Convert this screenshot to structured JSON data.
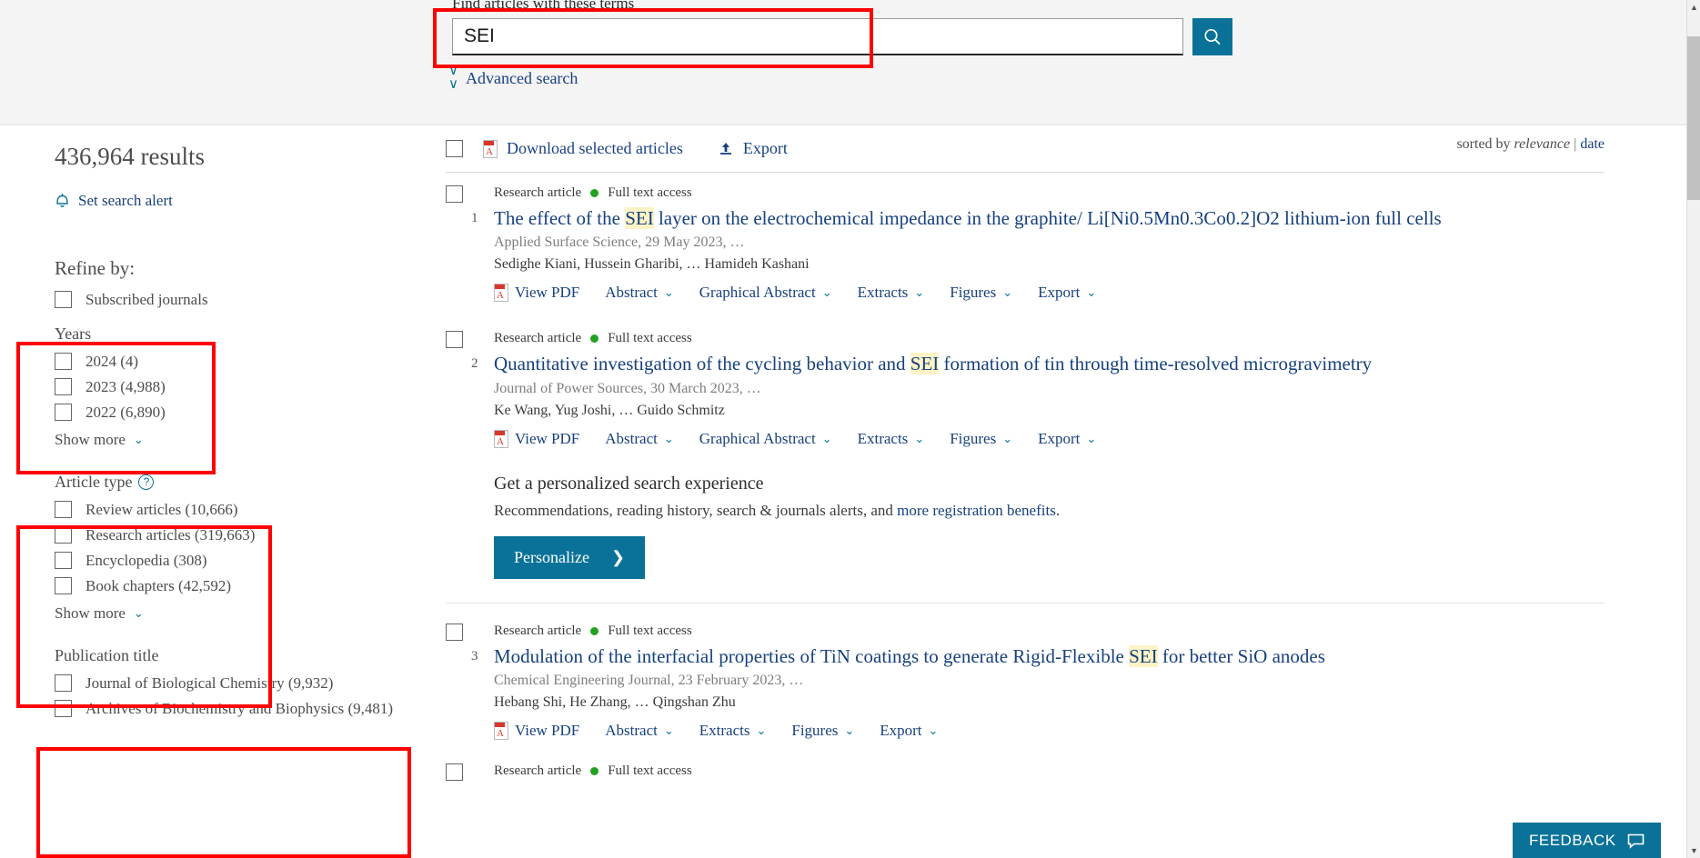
{
  "search": {
    "label": "Find articles with these terms",
    "value": "SEI",
    "placeholder": "",
    "button_icon": "search-icon",
    "advanced_search": "Advanced search"
  },
  "sidebar": {
    "results_count": "436,964 results",
    "set_alert": "Set search alert",
    "refine_title": "Refine by:",
    "subscribed": {
      "label": "Subscribed journals"
    },
    "facets": [
      {
        "title": "Years",
        "help": false,
        "options": [
          {
            "label": "2024 (4)"
          },
          {
            "label": "2023 (4,988)"
          },
          {
            "label": "2022 (6,890)"
          }
        ],
        "show_more": "Show more"
      },
      {
        "title": "Article type",
        "help": true,
        "help_glyph": "?",
        "options": [
          {
            "label": "Review articles (10,666)"
          },
          {
            "label": "Research articles (319,663)"
          },
          {
            "label": "Encyclopedia (308)"
          },
          {
            "label": "Book chapters (42,592)"
          }
        ],
        "show_more": "Show more"
      },
      {
        "title": "Publication title",
        "help": false,
        "options": [
          {
            "label": "Journal of Biological Chemistry (9,932)"
          },
          {
            "label": "Archives of Biochemistry and Biophysics (9,481)"
          }
        ],
        "show_more": ""
      }
    ]
  },
  "toolbar": {
    "download_label": "Download selected articles",
    "export_label": "Export",
    "sorted_by_prefix": "sorted by ",
    "sort_relevance": "relevance",
    "sort_separator": "|",
    "sort_date": "date"
  },
  "results": [
    {
      "number": "1",
      "type": "Research article",
      "access": "Full text access",
      "title_pre": "The effect of the ",
      "title_hl": "SEI",
      "title_post": " layer on the electrochemical impedance in the graphite/ Li[Ni0.5Mn0.3Co0.2]O2 lithium-ion full cells",
      "meta": "Applied Surface Science, 29 May 2023, …",
      "authors": "Sedighe Kiani, Hussein Gharibi, … Hamideh Kashani",
      "actions": [
        "View PDF",
        "Abstract",
        "Graphical Abstract",
        "Extracts",
        "Figures",
        "Export"
      ]
    },
    {
      "number": "2",
      "type": "Research article",
      "access": "Full text access",
      "title_pre": "Quantitative investigation of the cycling behavior and ",
      "title_hl": "SEI",
      "title_post": " formation of tin through time-resolved microgravimetry",
      "meta": "Journal of Power Sources, 30 March 2023, …",
      "authors": "Ke Wang, Yug Joshi, … Guido Schmitz",
      "actions": [
        "View PDF",
        "Abstract",
        "Graphical Abstract",
        "Extracts",
        "Figures",
        "Export"
      ]
    },
    {
      "number": "3",
      "type": "Research article",
      "access": "Full text access",
      "title_pre": "Modulation of the interfacial properties of TiN coatings to generate Rigid-Flexible ",
      "title_hl": "SEI",
      "title_post": " for better SiO anodes",
      "meta": "Chemical Engineering Journal, 23 February 2023, …",
      "authors": "Hebang Shi, He Zhang, … Qingshan Zhu",
      "actions": [
        "View PDF",
        "Abstract",
        "Extracts",
        "Figures",
        "Export"
      ]
    }
  ],
  "partial_result": {
    "type": "Research article",
    "access": "Full text access"
  },
  "promo": {
    "title": "Get a personalized search experience",
    "subtitle_pre": "Recommendations, reading history, search & journals alerts, and ",
    "subtitle_link": "more registration benefits",
    "subtitle_post": ".",
    "button": "Personalize",
    "button_icon": "chevron-right-icon"
  },
  "feedback": {
    "label": "FEEDBACK",
    "icon": "speech-bubble-icon"
  },
  "colors": {
    "accent_teal": "#0a7298",
    "link_blue": "#17407e",
    "highlight_yellow": "#fdf3c6",
    "annotation_red": "#ff0000",
    "open_access_green": "#23a121"
  }
}
